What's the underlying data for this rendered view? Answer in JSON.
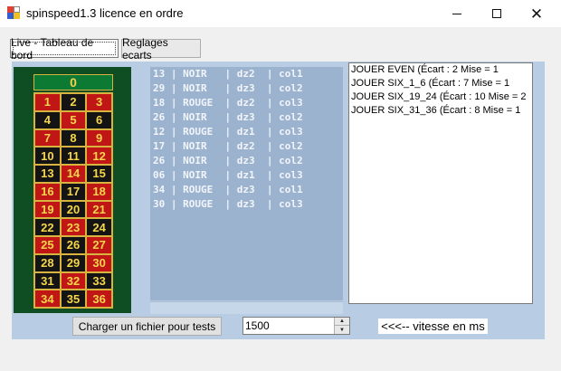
{
  "window": {
    "title": "spinspeed1.3 licence en ordre",
    "minimize_glyph": "",
    "maximize_glyph": "",
    "close_glyph": "✕"
  },
  "tabs": [
    {
      "label": "Live - Tableau de bord",
      "active": true
    },
    {
      "label": "Reglages ecarts",
      "active": false
    }
  ],
  "board": {
    "zero": "0",
    "rows": [
      [
        "1",
        "2",
        "3"
      ],
      [
        "4",
        "5",
        "6"
      ],
      [
        "7",
        "8",
        "9"
      ],
      [
        "10",
        "11",
        "12"
      ],
      [
        "13",
        "14",
        "15"
      ],
      [
        "16",
        "17",
        "18"
      ],
      [
        "19",
        "20",
        "21"
      ],
      [
        "22",
        "23",
        "24"
      ],
      [
        "25",
        "26",
        "27"
      ],
      [
        "28",
        "29",
        "30"
      ],
      [
        "31",
        "32",
        "33"
      ],
      [
        "34",
        "35",
        "36"
      ]
    ],
    "colors": {
      "1": "red",
      "2": "black",
      "3": "red",
      "4": "black",
      "5": "red",
      "6": "black",
      "7": "red",
      "8": "black",
      "9": "red",
      "10": "black",
      "11": "black",
      "12": "red",
      "13": "black",
      "14": "red",
      "15": "black",
      "16": "red",
      "17": "black",
      "18": "red",
      "19": "red",
      "20": "black",
      "21": "red",
      "22": "black",
      "23": "red",
      "24": "black",
      "25": "red",
      "26": "black",
      "27": "red",
      "28": "black",
      "29": "black",
      "30": "red",
      "31": "black",
      "32": "red",
      "33": "black",
      "34": "red",
      "35": "black",
      "36": "red"
    }
  },
  "spins": [
    "13 | NOIR   | dz2  | col1",
    "29 | NOIR   | dz3  | col2",
    "18 | ROUGE  | dz2  | col3",
    "26 | NOIR   | dz3  | col2",
    "12 | ROUGE  | dz1  | col3",
    "17 | NOIR   | dz2  | col2",
    "26 | NOIR   | dz3  | col2",
    "06 | NOIR   | dz1  | col3",
    "34 | ROUGE  | dz3  | col1",
    "30 | ROUGE  | dz3  | col3"
  ],
  "advice": [
    "JOUER EVEN (Écart : 2  Mise = 1",
    "JOUER SIX_1_6 (Écart : 7  Mise = 1",
    "JOUER SIX_19_24 (Écart : 10  Mise = 2",
    "JOUER SIX_31_36 (Écart : 8  Mise = 1"
  ],
  "controls": {
    "load_button": "Charger un fichier pour tests",
    "speed_value": "1500",
    "speed_label": "<<<-- vitesse en ms"
  },
  "colors": {
    "panel": "#b8cce4",
    "board": "#0f4d22",
    "red": "#c01616",
    "black": "#141414",
    "gold": "#d9b340"
  }
}
